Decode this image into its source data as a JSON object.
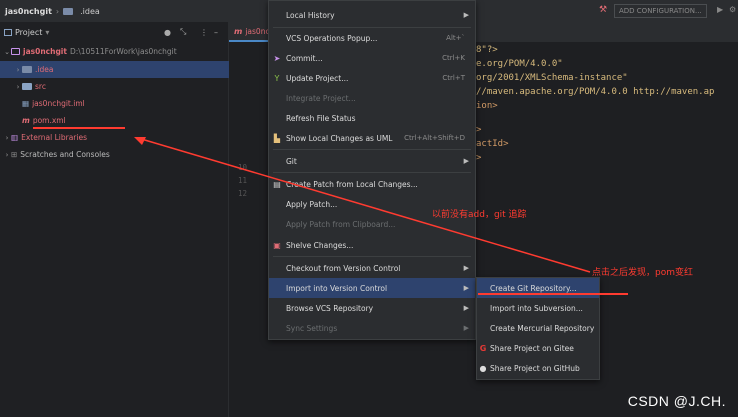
{
  "breadcrumb": {
    "project": "jas0nchgit",
    "folder": ".idea"
  },
  "project_panel": {
    "title": "Project",
    "tree": [
      {
        "name": "jas0nchgit",
        "path": "D:\\10511ForWork\\jas0nchgit"
      },
      {
        "name": ".idea"
      },
      {
        "name": "src"
      },
      {
        "name": "jas0nchgit.iml"
      },
      {
        "name": "pom.xml"
      },
      {
        "name": "External Libraries"
      },
      {
        "name": "Scratches and Consoles"
      }
    ]
  },
  "editor": {
    "tab": "jas0nc",
    "toolbar_button": "ADD CONFIGURATION...",
    "line_numbers": [
      "10",
      "11",
      "12"
    ],
    "code_lines": [
      "8\"?>",
      "e.org/POM/4.0.0\"",
      "org/2001/XMLSchema-instance\"",
      "//maven.apache.org/POM/4.0.0 http://maven.ap",
      "ion>",
      ">",
      "actId>",
      ">"
    ]
  },
  "vcs_menu": {
    "items": [
      {
        "label": "Local History",
        "arrow": true
      },
      {
        "label": "VCS Operations Popup...",
        "shortcut": "Alt+`"
      },
      {
        "label": "Commit...",
        "shortcut": "Ctrl+K",
        "icon": "commit-icon"
      },
      {
        "label": "Update Project...",
        "shortcut": "Ctrl+T",
        "icon": "update-icon"
      },
      {
        "label": "Integrate Project...",
        "disabled": true
      },
      {
        "label": "Refresh File Status"
      },
      {
        "label": "Show Local Changes as UML",
        "shortcut": "Ctrl+Alt+Shift+D",
        "icon": "uml-icon"
      },
      {
        "label": "Git",
        "arrow": true
      },
      {
        "label": "Create Patch from Local Changes...",
        "icon": "patch-icon"
      },
      {
        "label": "Apply Patch..."
      },
      {
        "label": "Apply Patch from Clipboard...",
        "disabled": true
      },
      {
        "label": "Shelve Changes...",
        "icon": "shelve-icon"
      },
      {
        "label": "Checkout from Version Control",
        "arrow": true
      },
      {
        "label": "Import into Version Control",
        "arrow": true,
        "active": true
      },
      {
        "label": "Browse VCS Repository",
        "arrow": true
      },
      {
        "label": "Sync Settings",
        "arrow": true,
        "disabled": true
      }
    ]
  },
  "import_submenu": {
    "items": [
      {
        "label": "Create Git Repository...",
        "active": true
      },
      {
        "label": "Import into Subversion..."
      },
      {
        "label": "Create Mercurial Repository"
      },
      {
        "label": "Share Project on Gitee",
        "icon": "gitee-icon"
      },
      {
        "label": "Share Project on GitHub",
        "icon": "github-icon"
      }
    ]
  },
  "annotations": {
    "note1": "以前没有add，git 追踪",
    "note2": "点击之后发现，pom变红"
  },
  "watermark": "CSDN @J.CH.",
  "colors": {
    "accent_red": "#ff3b30",
    "selection": "#2e436e",
    "pom_red": "#e06c75"
  }
}
